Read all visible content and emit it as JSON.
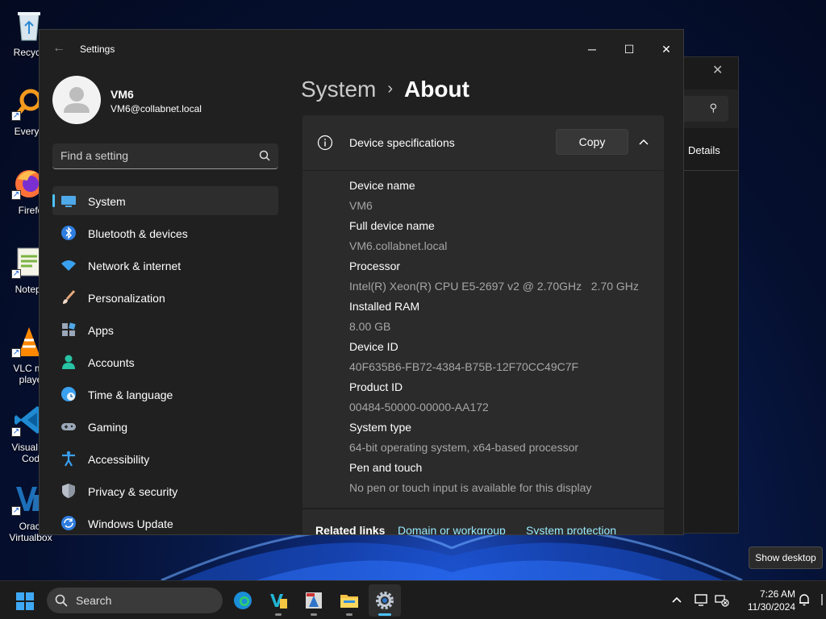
{
  "desktop": {
    "icons": [
      {
        "label": "Recycle",
        "icon": "recycle-bin-icon"
      },
      {
        "label": "Everyth",
        "icon": "everything-search-icon"
      },
      {
        "label": "Firefo",
        "icon": "firefox-icon"
      },
      {
        "label": "Notepa",
        "icon": "notepad-plus-plus-icon"
      },
      {
        "label": "VLC me\nplaye",
        "icon": "vlc-icon"
      },
      {
        "label": "Visual St\nCod",
        "icon": "vscode-icon"
      },
      {
        "label": "Oracl\nVirtualbox",
        "icon": "virtualbox-icon"
      }
    ]
  },
  "background_window": {
    "details_label": "Details"
  },
  "settings": {
    "title": "Settings",
    "user": {
      "name": "VM6",
      "email": "VM6@collabnet.local"
    },
    "search": {
      "placeholder": "Find a setting"
    },
    "nav": [
      {
        "label": "System",
        "icon": "system-icon",
        "active": true
      },
      {
        "label": "Bluetooth & devices",
        "icon": "bluetooth-icon"
      },
      {
        "label": "Network & internet",
        "icon": "wifi-icon"
      },
      {
        "label": "Personalization",
        "icon": "brush-icon"
      },
      {
        "label": "Apps",
        "icon": "apps-icon"
      },
      {
        "label": "Accounts",
        "icon": "accounts-icon"
      },
      {
        "label": "Time & language",
        "icon": "globe-clock-icon"
      },
      {
        "label": "Gaming",
        "icon": "gamepad-icon"
      },
      {
        "label": "Accessibility",
        "icon": "accessibility-icon"
      },
      {
        "label": "Privacy & security",
        "icon": "shield-icon"
      },
      {
        "label": "Windows Update",
        "icon": "update-icon"
      }
    ],
    "breadcrumb": {
      "parent": "System",
      "separator": "›",
      "current": "About"
    },
    "device_specs": {
      "title": "Device specifications",
      "copy_label": "Copy",
      "items": [
        {
          "key": "Device name",
          "value": "VM6"
        },
        {
          "key": "Full device name",
          "value": "VM6.collabnet.local"
        },
        {
          "key": "Processor",
          "value": "Intel(R) Xeon(R) CPU E5-2697 v2 @ 2.70GHz   2.70 GHz"
        },
        {
          "key": "Installed RAM",
          "value": "8.00 GB"
        },
        {
          "key": "Device ID",
          "value": "40F635B6-FB72-4384-B75B-12F70CC49C7F"
        },
        {
          "key": "Product ID",
          "value": "00484-50000-00000-AA172"
        },
        {
          "key": "System type",
          "value": "64-bit operating system, x64-based processor"
        },
        {
          "key": "Pen and touch",
          "value": "No pen or touch input is available for this display"
        }
      ]
    },
    "related_links": {
      "title": "Related links",
      "links": [
        "Domain or workgroup",
        "System protection"
      ]
    }
  },
  "tooltip": "Show desktop",
  "taskbar": {
    "search_label": "Search",
    "apps": [
      "edge-icon",
      "visual-studio-icon",
      "nsis-installer-icon",
      "file-explorer-icon",
      "settings-gear-icon"
    ],
    "clock": {
      "time": "7:26 AM",
      "date": "11/30/2024"
    }
  },
  "colors": {
    "accent": "#4cc2ff",
    "link": "#99ebff",
    "window_bg": "#202020",
    "card_bg": "#2b2b2b"
  }
}
